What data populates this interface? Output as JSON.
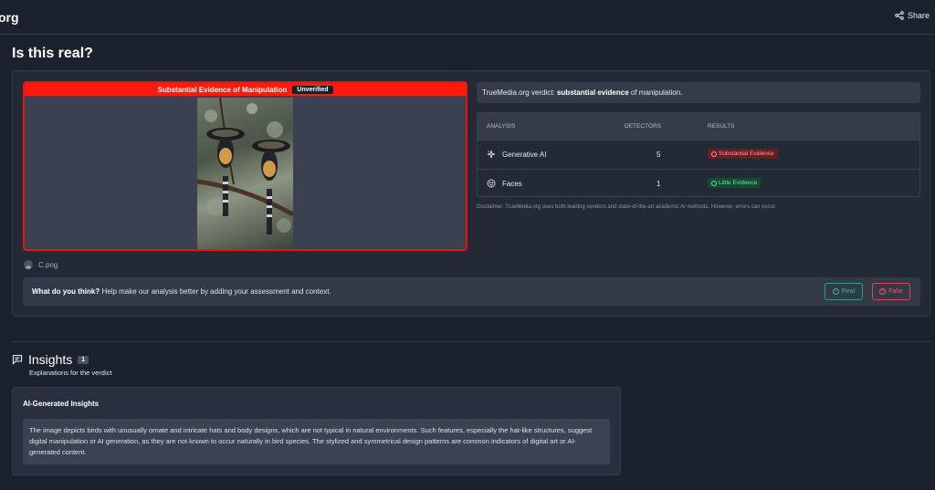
{
  "topbar": {
    "brand": "org",
    "share_label": "Share"
  },
  "page": {
    "title": "Is this real?"
  },
  "media": {
    "verdict_label": "Substantial Evidence of Manipulation",
    "status_badge": "Unverified",
    "file_name": "C.png"
  },
  "verdict": {
    "prefix": "TrueMedia.org verdict: ",
    "strong": "substantial evidence",
    "suffix": " of manipulation."
  },
  "analysis": {
    "headers": {
      "analysis": "ANALYSIS",
      "detectors": "DETECTORS",
      "results": "RESULTS"
    },
    "rows": [
      {
        "name": "Generative AI",
        "detectors": "5",
        "result": "Substantial Evidence",
        "icon": "sparkles-icon"
      },
      {
        "name": "Faces",
        "detectors": "1",
        "result": "Little Evidence",
        "icon": "face-icon"
      }
    ]
  },
  "disclaimer": "Disclaimer: TrueMedia.org uses both leading vendors and state-of-the-art academic AI methods. However, errors can occur.",
  "feedback": {
    "question": "What do you think?",
    "prompt": " Help make our analysis better by adding your assessment and context.",
    "real_label": "Real",
    "fake_label": "Fake"
  },
  "insights": {
    "title": "Insights",
    "count": "1",
    "subtitle": "Explanations for the verdict",
    "card_title": "AI-Generated Insights",
    "body": "The image depicts birds with unusually ornate and intricate hats and body designs, which are not typical in natural environments. Such features, especially the hat-like structures, suggest digital manipulation or AI generation, as they are not known to occur naturally in bird species. The stylized and symmetrical design patterns are common indicators of digital art or AI-generated content."
  },
  "colors": {
    "background": "#1c222d",
    "manipulation_red": "#ff1a0f",
    "real_green": "#36b39a",
    "fake_red": "#e85a66"
  }
}
